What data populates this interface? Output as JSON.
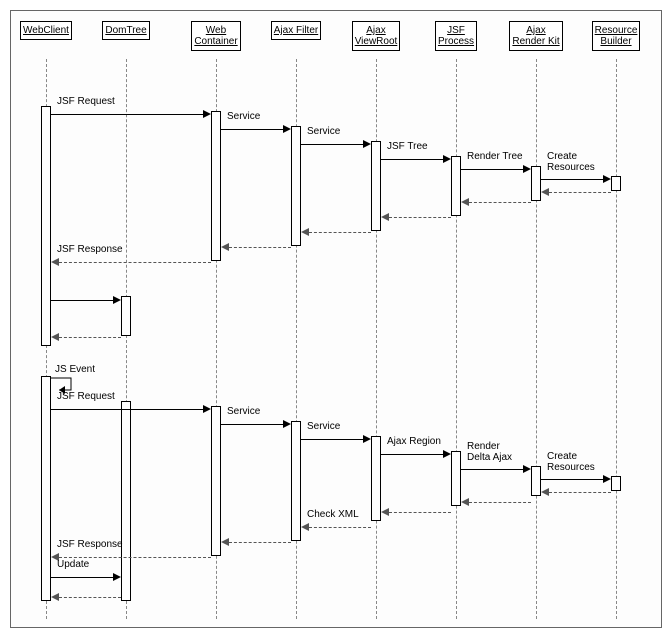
{
  "participants": [
    {
      "id": "webclient",
      "label": "WebClient"
    },
    {
      "id": "domtree",
      "label": "DomTree"
    },
    {
      "id": "webcontainer",
      "label": "Web\nContainer"
    },
    {
      "id": "ajaxfilter",
      "label": "Ajax Filter"
    },
    {
      "id": "ajaxviewroot",
      "label": "Ajax\nViewRoot"
    },
    {
      "id": "jsfprocess",
      "label": "JSF\nProcess"
    },
    {
      "id": "ajaxrenderkit",
      "label": "Ajax\nRender Kit"
    },
    {
      "id": "resourcebuilder",
      "label": "Resource\nBuilder"
    }
  ],
  "messages": {
    "jsf_request1": "JSF Request",
    "service1a": "Service",
    "service1b": "Service",
    "jsf_tree": "JSF Tree",
    "render_tree": "Render Tree",
    "create_res1": "Create\nResources",
    "jsf_response1": "JSF Response",
    "js_event": "JS Event",
    "jsf_request2": "JSF Request",
    "service2a": "Service",
    "service2b": "Service",
    "ajax_region": "Ajax Region",
    "render_delta": "Render\nDelta Ajax",
    "create_res2": "Create\nResources",
    "check_xml": "Check XML",
    "jsf_response2": "JSF Response",
    "update": "Update"
  },
  "chart_data": {
    "type": "sequence_diagram",
    "participants": [
      "WebClient",
      "DomTree",
      "Web Container",
      "Ajax Filter",
      "Ajax ViewRoot",
      "JSF Process",
      "Ajax Render Kit",
      "Resource Builder"
    ],
    "interactions": [
      {
        "phase": 1,
        "from": "WebClient",
        "to": "Web Container",
        "label": "JSF Request",
        "kind": "call"
      },
      {
        "phase": 1,
        "from": "Web Container",
        "to": "Ajax Filter",
        "label": "Service",
        "kind": "call"
      },
      {
        "phase": 1,
        "from": "Ajax Filter",
        "to": "Ajax ViewRoot",
        "label": "Service",
        "kind": "call"
      },
      {
        "phase": 1,
        "from": "Ajax ViewRoot",
        "to": "JSF Process",
        "label": "JSF Tree",
        "kind": "call"
      },
      {
        "phase": 1,
        "from": "JSF Process",
        "to": "Ajax Render Kit",
        "label": "Render Tree",
        "kind": "call"
      },
      {
        "phase": 1,
        "from": "Ajax Render Kit",
        "to": "Resource Builder",
        "label": "Create Resources",
        "kind": "call"
      },
      {
        "phase": 1,
        "from": "Resource Builder",
        "to": "Ajax Render Kit",
        "label": "",
        "kind": "return"
      },
      {
        "phase": 1,
        "from": "Ajax Render Kit",
        "to": "JSF Process",
        "label": "",
        "kind": "return"
      },
      {
        "phase": 1,
        "from": "JSF Process",
        "to": "Ajax ViewRoot",
        "label": "",
        "kind": "return"
      },
      {
        "phase": 1,
        "from": "Ajax ViewRoot",
        "to": "Ajax Filter",
        "label": "",
        "kind": "return"
      },
      {
        "phase": 1,
        "from": "Ajax Filter",
        "to": "Web Container",
        "label": "",
        "kind": "return"
      },
      {
        "phase": 1,
        "from": "Web Container",
        "to": "WebClient",
        "label": "JSF Response",
        "kind": "return"
      },
      {
        "phase": 1,
        "from": "WebClient",
        "to": "DomTree",
        "label": "",
        "kind": "call"
      },
      {
        "phase": 1,
        "from": "DomTree",
        "to": "WebClient",
        "label": "",
        "kind": "return"
      },
      {
        "phase": 2,
        "from": "WebClient",
        "to": "WebClient",
        "label": "JS Event",
        "kind": "self"
      },
      {
        "phase": 2,
        "from": "WebClient",
        "to": "Web Container",
        "label": "JSF Request",
        "kind": "call"
      },
      {
        "phase": 2,
        "from": "Web Container",
        "to": "Ajax Filter",
        "label": "Service",
        "kind": "call"
      },
      {
        "phase": 2,
        "from": "Ajax Filter",
        "to": "Ajax ViewRoot",
        "label": "Service",
        "kind": "call"
      },
      {
        "phase": 2,
        "from": "Ajax ViewRoot",
        "to": "JSF Process",
        "label": "Ajax Region",
        "kind": "call"
      },
      {
        "phase": 2,
        "from": "JSF Process",
        "to": "Ajax Render Kit",
        "label": "Render Delta Ajax",
        "kind": "call"
      },
      {
        "phase": 2,
        "from": "Ajax Render Kit",
        "to": "Resource Builder",
        "label": "Create Resources",
        "kind": "call"
      },
      {
        "phase": 2,
        "from": "Resource Builder",
        "to": "Ajax Render Kit",
        "label": "",
        "kind": "return"
      },
      {
        "phase": 2,
        "from": "Ajax Render Kit",
        "to": "JSF Process",
        "label": "",
        "kind": "return"
      },
      {
        "phase": 2,
        "from": "JSF Process",
        "to": "Ajax ViewRoot",
        "label": "",
        "kind": "return"
      },
      {
        "phase": 2,
        "from": "Ajax ViewRoot",
        "to": "Ajax Filter",
        "label": "Check XML",
        "kind": "return"
      },
      {
        "phase": 2,
        "from": "Ajax Filter",
        "to": "Web Container",
        "label": "",
        "kind": "return"
      },
      {
        "phase": 2,
        "from": "Web Container",
        "to": "WebClient",
        "label": "JSF Response",
        "kind": "return"
      },
      {
        "phase": 2,
        "from": "WebClient",
        "to": "DomTree",
        "label": "Update",
        "kind": "call"
      },
      {
        "phase": 2,
        "from": "DomTree",
        "to": "WebClient",
        "label": "",
        "kind": "return"
      }
    ]
  }
}
